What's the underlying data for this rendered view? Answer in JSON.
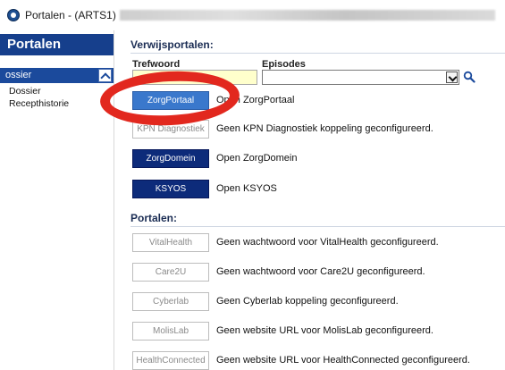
{
  "window": {
    "title": "Portalen - (ARTS1)",
    "icon": "app-globe-icon"
  },
  "sidebar": {
    "header": "Portalen",
    "group_label": "ossier",
    "items": [
      {
        "label": "Dossier"
      },
      {
        "label": "Recepthistorie"
      }
    ]
  },
  "main": {
    "section1_title": "Verwijsportalen:",
    "trefwoord_label": "Trefwoord",
    "episodes_label": "Episodes",
    "trefwoord_value": "",
    "episodes_value": "",
    "verwijs": [
      {
        "button": "ZorgPortaal",
        "text": "Open ZorgPortaal"
      },
      {
        "button": "KPN Diagnostiek",
        "text": "Geen KPN Diagnostiek koppeling geconfigureerd."
      },
      {
        "button": "ZorgDomein",
        "text": "Open ZorgDomein"
      },
      {
        "button": "KSYOS",
        "text": "Open KSYOS"
      }
    ],
    "section2_title": "Portalen:",
    "portalen": [
      {
        "button": "VitalHealth",
        "text": "Geen wachtwoord voor VitalHealth geconfigureerd."
      },
      {
        "button": "Care2U",
        "text": "Geen wachtwoord voor Care2U geconfigureerd."
      },
      {
        "button": "Cyberlab",
        "text": "Geen Cyberlab koppeling geconfigureerd."
      },
      {
        "button": "MolisLab",
        "text": "Geen website URL voor MolisLab geconfigureerd."
      },
      {
        "button": "HealthConnected",
        "text": "Geen website URL voor HealthConnected geconfigureerd."
      }
    ]
  },
  "colors": {
    "accent_navy": "#0d2b7a",
    "active_button": "#3a78cc",
    "sidebar_header": "#163f8c",
    "input_highlight": "#ffffcc",
    "annotation_red": "#e2281e"
  }
}
